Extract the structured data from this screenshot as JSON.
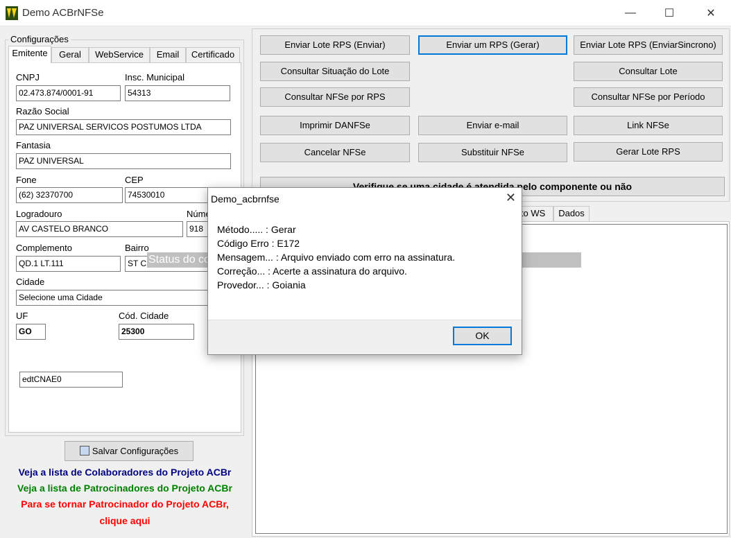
{
  "window": {
    "title": "Demo ACBrNFSe"
  },
  "config": {
    "group_label": "Configurações",
    "tabs": [
      "Emitente",
      "Geral",
      "WebService",
      "Email",
      "Certificado"
    ],
    "fields": {
      "cnpj": {
        "label": "CNPJ",
        "value": "02.473.874/0001-91"
      },
      "insc_municipal": {
        "label": "Insc. Municipal",
        "value": "54313"
      },
      "razao_social": {
        "label": "Razão Social",
        "value": "PAZ UNIVERSAL SERVICOS POSTUMOS LTDA"
      },
      "fantasia": {
        "label": "Fantasia",
        "value": "PAZ UNIVERSAL"
      },
      "fone": {
        "label": "Fone",
        "value": "(62) 32370700"
      },
      "cep": {
        "label": "CEP",
        "value": "74530010"
      },
      "logradouro": {
        "label": "Logradouro",
        "value": "AV CASTELO BRANCO"
      },
      "numero": {
        "label": "Núme",
        "value": "918"
      },
      "complemento": {
        "label": "Complemento",
        "value": "QD.1 LT.111"
      },
      "bairro": {
        "label": "Bairro",
        "value": "ST C"
      },
      "cidade": {
        "label": "Cidade",
        "value": "Selecione uma Cidade"
      },
      "uf": {
        "label": "UF",
        "value": "GO"
      },
      "cod_cidade": {
        "label": "Cód. Cidade",
        "value": "25300"
      },
      "cnae": {
        "value": "edtCNAE0"
      }
    },
    "save_button": "Salvar Configurações"
  },
  "links": {
    "colaboradores": "Veja a lista de Colaboradores do Projeto ACBr",
    "patrocinadores": "Veja a lista de Patrocinadores do Projeto ACBr",
    "tornar_patrocinador_1": "Para se tornar Patrocinador do Projeto ACBr,",
    "tornar_patrocinador_2": "clique aqui",
    "colors": {
      "colaboradores": "#000080",
      "patrocinadores": "#008000",
      "tornar": "#ff0000"
    }
  },
  "actions": {
    "enviar_lote": "Enviar Lote RPS (Enviar)",
    "enviar_um_rps": "Enviar um RPS (Gerar)",
    "enviar_lote_sincrono": "Enviar Lote RPS (EnviarSincrono)",
    "consultar_situacao_lote": "Consultar Situação do Lote",
    "consultar_lote": "Consultar Lote",
    "consultar_nfse_rps": "Consultar NFSe por RPS",
    "consultar_nfse_periodo": "Consultar NFSe por Período",
    "imprimir_danfse": "Imprimir DANFSe",
    "enviar_email": "Enviar e-mail",
    "link_nfse": "Link NFSe",
    "cancelar_nfse": "Cancelar NFSe",
    "substituir_nfse": "Substituir NFSe",
    "gerar_lote_rps": "Gerar Lote RPS",
    "verifique_cidade": "Verifique se uma cidade é atendida pelo componente ou não"
  },
  "right_tabs": [
    "eto WS",
    "Dados"
  ],
  "status_overlay": "Status do co",
  "dialog": {
    "title": "Demo_acbrnfse",
    "lines": [
      "Método..... : Gerar",
      "Código Erro : E172",
      "Mensagem... : Arquivo enviado com erro na assinatura.",
      "Correção... : Acerte a assinatura do arquivo.",
      "Provedor... : Goiania"
    ],
    "ok": "OK"
  }
}
